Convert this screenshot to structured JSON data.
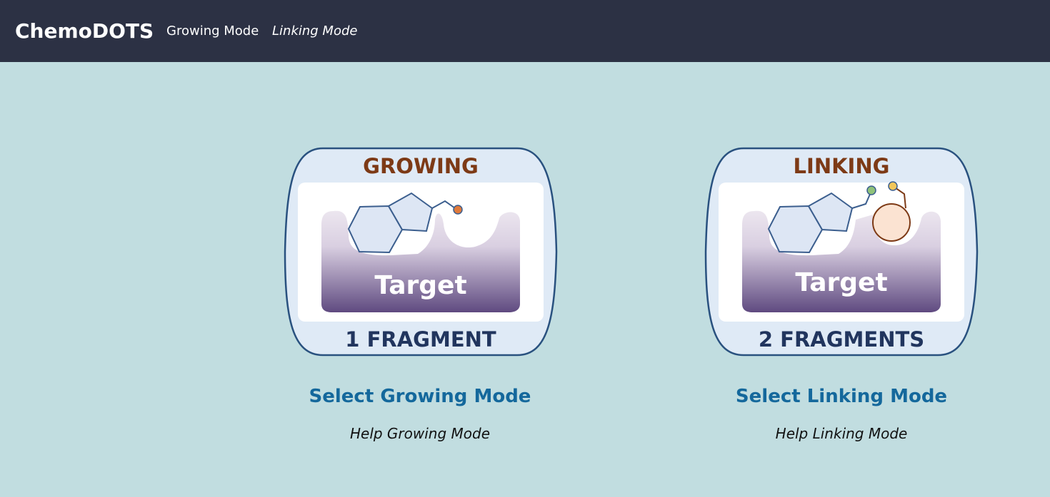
{
  "navbar": {
    "brand": "ChemoDOTS",
    "links": [
      {
        "label": "Growing Mode"
      },
      {
        "label": "Linking Mode"
      }
    ]
  },
  "modes": [
    {
      "badge_title": "GROWING",
      "badge_target": "Target",
      "badge_fragments": "1 FRAGMENT",
      "select_label": "Select Growing Mode",
      "help_label": "Help Growing Mode"
    },
    {
      "badge_title": "LINKING",
      "badge_target": "Target",
      "badge_fragments": "2 FRAGMENTS",
      "select_label": "Select Linking Mode",
      "help_label": "Help Linking Mode"
    }
  ],
  "colors": {
    "navbar_bg": "#2c3144",
    "page_bg": "#c1dde0",
    "link_blue": "#14689c",
    "badge_title": "#7d3a16",
    "badge_fragments": "#21355e",
    "target_purple": "#5f4a80",
    "growing_dot": "#e07a3c",
    "linking_dot_green": "#8fc27a",
    "linking_dot_yellow": "#f2c65a",
    "linking_circle_fill": "#fbe3d2"
  },
  "icons": [
    "growing-mode-icon",
    "linking-mode-icon"
  ]
}
